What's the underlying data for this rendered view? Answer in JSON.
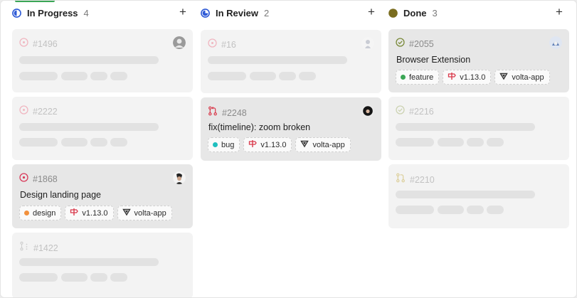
{
  "columns": [
    {
      "title": "In Progress",
      "count": "4",
      "add_label": "+",
      "status_icon": "half-circle-icon",
      "color": "#2f5bd6",
      "cards": [
        {
          "id": "#1496"
        },
        {
          "id": "#2222"
        },
        {
          "id": "#1868",
          "title": "Design landing page",
          "tags": [
            {
              "label": "design",
              "dot_color": "#f2913d"
            },
            {
              "label": "v1.13.0",
              "icon": "milestone-icon"
            },
            {
              "label": "volta-app",
              "icon": "project-icon"
            }
          ]
        },
        {
          "id": "#1422"
        }
      ]
    },
    {
      "title": "In Review",
      "count": "2",
      "add_label": "+",
      "status_icon": "three-quarter-circle-icon",
      "color": "#2f5bd6",
      "cards": [
        {
          "id": "#16"
        },
        {
          "id": "#2248",
          "title": "fix(timeline): zoom broken",
          "tags": [
            {
              "label": "bug",
              "dot_color": "#1fbfbf"
            },
            {
              "label": "v1.13.0",
              "icon": "milestone-icon"
            },
            {
              "label": "volta-app",
              "icon": "project-icon"
            }
          ]
        }
      ]
    },
    {
      "title": "Done",
      "count": "3",
      "add_label": "+",
      "status_icon": "filled-circle-icon",
      "color": "#7a6d1f",
      "cards": [
        {
          "id": "#2055",
          "title": "Browser Extension",
          "tags": [
            {
              "label": "feature",
              "dot_color": "#3aa655"
            },
            {
              "label": "v1.13.0",
              "icon": "milestone-icon"
            },
            {
              "label": "volta-app",
              "icon": "project-icon"
            }
          ]
        },
        {
          "id": "#2216"
        },
        {
          "id": "#2210"
        }
      ]
    }
  ]
}
